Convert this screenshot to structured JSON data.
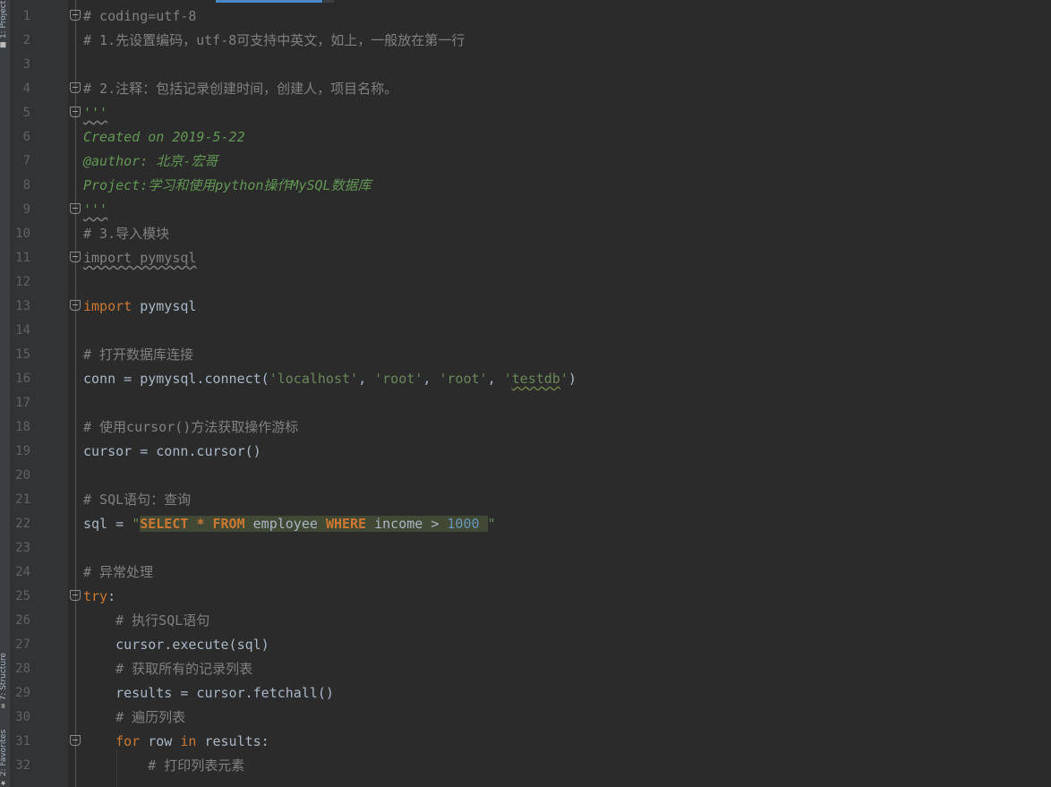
{
  "sidebar": {
    "top_tab": "1: Project",
    "structure_tab": "7: Structure",
    "favorites_tab": "2: Favorites"
  },
  "editor": {
    "lines": [
      {
        "n": "1",
        "t": "# coding=utf-8"
      },
      {
        "n": "2",
        "t": "# 1.先设置编码，utf-8可支持中英文，如上，一般放在第一行"
      },
      {
        "n": "3",
        "t": ""
      },
      {
        "n": "4",
        "t": "# 2.注释：包括记录创建时间，创建人，项目名称。"
      },
      {
        "n": "5",
        "t": "'''"
      },
      {
        "n": "6",
        "t": "Created on 2019-5-22"
      },
      {
        "n": "7",
        "t": "@author: 北京-宏哥"
      },
      {
        "n": "8",
        "t": "Project:学习和使用python操作MySQL数据库"
      },
      {
        "n": "9",
        "t": "'''"
      },
      {
        "n": "10",
        "t": "# 3.导入模块"
      },
      {
        "n": "11",
        "kw": "import",
        "rest": " pymysql"
      },
      {
        "n": "12",
        "t": ""
      },
      {
        "n": "13",
        "kw": "import",
        "rest": " pymysql"
      },
      {
        "n": "14",
        "t": ""
      },
      {
        "n": "15",
        "t": "# 打开数据库连接"
      },
      {
        "n": "16",
        "pre": "conn = pymysql.connect(",
        "a1": "'localhost'",
        "s1": ", ",
        "a2": "'root'",
        "s2": ", ",
        "a3": "'root'",
        "s3": ", ",
        "a4q": "'",
        "a4": "testdb",
        "a4e": "'",
        "post": ")"
      },
      {
        "n": "17",
        "t": ""
      },
      {
        "n": "18",
        "t": "# 使用cursor()方法获取操作游标"
      },
      {
        "n": "19",
        "t": "cursor = conn.cursor()"
      },
      {
        "n": "20",
        "t": ""
      },
      {
        "n": "21",
        "t": "# SQL语句：查询"
      },
      {
        "n": "22",
        "pre": "sql = ",
        "q1": "\"",
        "k1": "SELECT",
        "s1": " ",
        "op": "*",
        "s2": " ",
        "k2": "FROM",
        "id1": " employee ",
        "k3": "WHERE",
        "id2": " income ",
        "gt": ">",
        "s3": " ",
        "num": "1000",
        "s4": " ",
        "q2": "\""
      },
      {
        "n": "23",
        "t": ""
      },
      {
        "n": "24",
        "t": "# 异常处理"
      },
      {
        "n": "25",
        "kw": "try",
        "rest": ":"
      },
      {
        "n": "26",
        "t": "    # 执行SQL语句"
      },
      {
        "n": "27",
        "t": "    cursor.execute(sql)"
      },
      {
        "n": "28",
        "t": "    # 获取所有的记录列表"
      },
      {
        "n": "29",
        "t": "    results = cursor.fetchall()"
      },
      {
        "n": "30",
        "t": "    # 遍历列表"
      },
      {
        "n": "31",
        "ind": "    ",
        "kw1": "for",
        "mid": " row ",
        "kw2": "in",
        "rest": " results:"
      },
      {
        "n": "32",
        "t": "        # 打印列表元素"
      }
    ]
  }
}
